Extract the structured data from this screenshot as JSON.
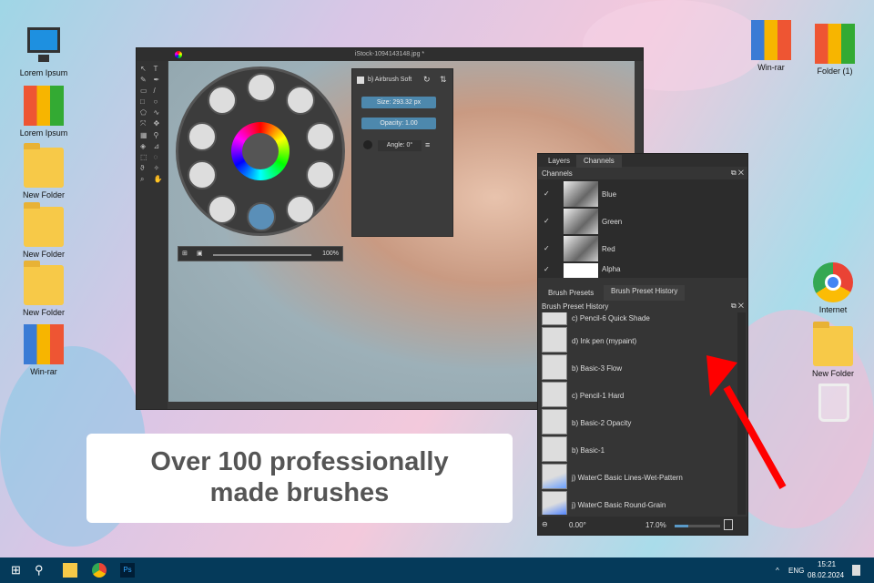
{
  "desktop_left": [
    {
      "label": "Lorem Ipsum",
      "icon": "computer-icon"
    },
    {
      "label": "Lorem Ipsum",
      "icon": "binders-icon"
    },
    {
      "label": "New Folder",
      "icon": "folder-icon"
    },
    {
      "label": "New Folder",
      "icon": "folder-icon"
    },
    {
      "label": "New Folder",
      "icon": "folder-icon"
    },
    {
      "label": "Win-rar",
      "icon": "winrar-icon"
    }
  ],
  "desktop_right": [
    {
      "label": "Win-rar",
      "icon": "winrar-icon"
    },
    {
      "label": "Folder (1)",
      "icon": "binders-icon"
    },
    {
      "label": "Internet",
      "icon": "chrome-icon"
    },
    {
      "label": "New Folder",
      "icon": "folder-icon"
    }
  ],
  "app": {
    "title": "iStock-1094143148.jpg *",
    "zoom": "100%",
    "brush_panel": {
      "name": "b) Airbrush Soft",
      "size": "Size: 293.32 px",
      "opacity": "Opacity: 1.00",
      "angle": "Angle: 0°"
    }
  },
  "dock": {
    "top_tabs": [
      "Layers",
      "Channels"
    ],
    "channels_title": "Channels",
    "channels": [
      "Blue",
      "Green",
      "Red",
      "Alpha"
    ],
    "bottom_tabs": [
      "Brush Presets",
      "Brush Preset History"
    ],
    "history_title": "Brush Preset History",
    "brushes": [
      "c) Pencil-6 Quick Shade",
      "d) Ink pen (mypaint)",
      "b) Basic-3 Flow",
      "c) Pencil-1 Hard",
      "b) Basic-2 Opacity",
      "b) Basic-1",
      "j) WaterC Basic Lines-Wet-Pattern",
      "j) WaterC Basic Round-Grain"
    ],
    "rotation": "0.00°",
    "zoom": "17.0%",
    "zoom_fraction": 0.3
  },
  "caption": {
    "line1": "Over 100 professionally",
    "line2": "made brushes"
  },
  "taskbar": {
    "lang": "ENG",
    "time": "15:21",
    "date": "08.02.2024"
  },
  "colors": {
    "arrow": "#ff0000",
    "taskbar": "#053a5a",
    "field": "#4d88ad"
  }
}
